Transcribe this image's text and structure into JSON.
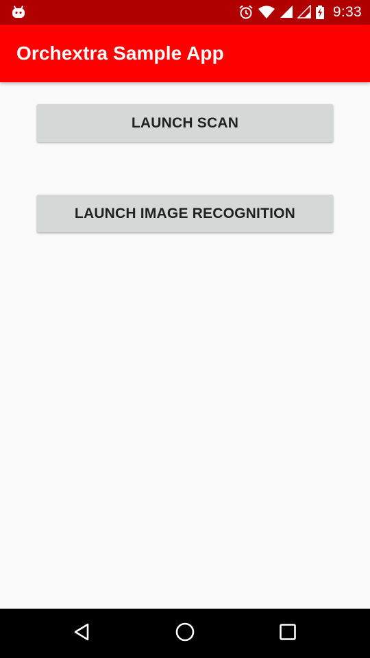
{
  "status_bar": {
    "time": "9:33",
    "icons": [
      "android-notification-icon",
      "alarm-icon",
      "wifi-icon",
      "signal-icon",
      "signal-icon",
      "battery-charging-icon"
    ]
  },
  "app_bar": {
    "title": "Orchextra Sample App"
  },
  "main": {
    "launch_scan_label": "LAUNCH SCAN",
    "launch_image_recognition_label": "LAUNCH IMAGE RECOGNITION"
  },
  "nav_bar": {
    "icons": [
      "back-icon",
      "home-icon",
      "recents-icon"
    ]
  },
  "colors": {
    "status_bar": "#b00000",
    "app_bar": "#ff0000",
    "background": "#fafafa",
    "button": "#d6d7d7",
    "button_text": "#212121",
    "nav_bar": "#000000"
  }
}
